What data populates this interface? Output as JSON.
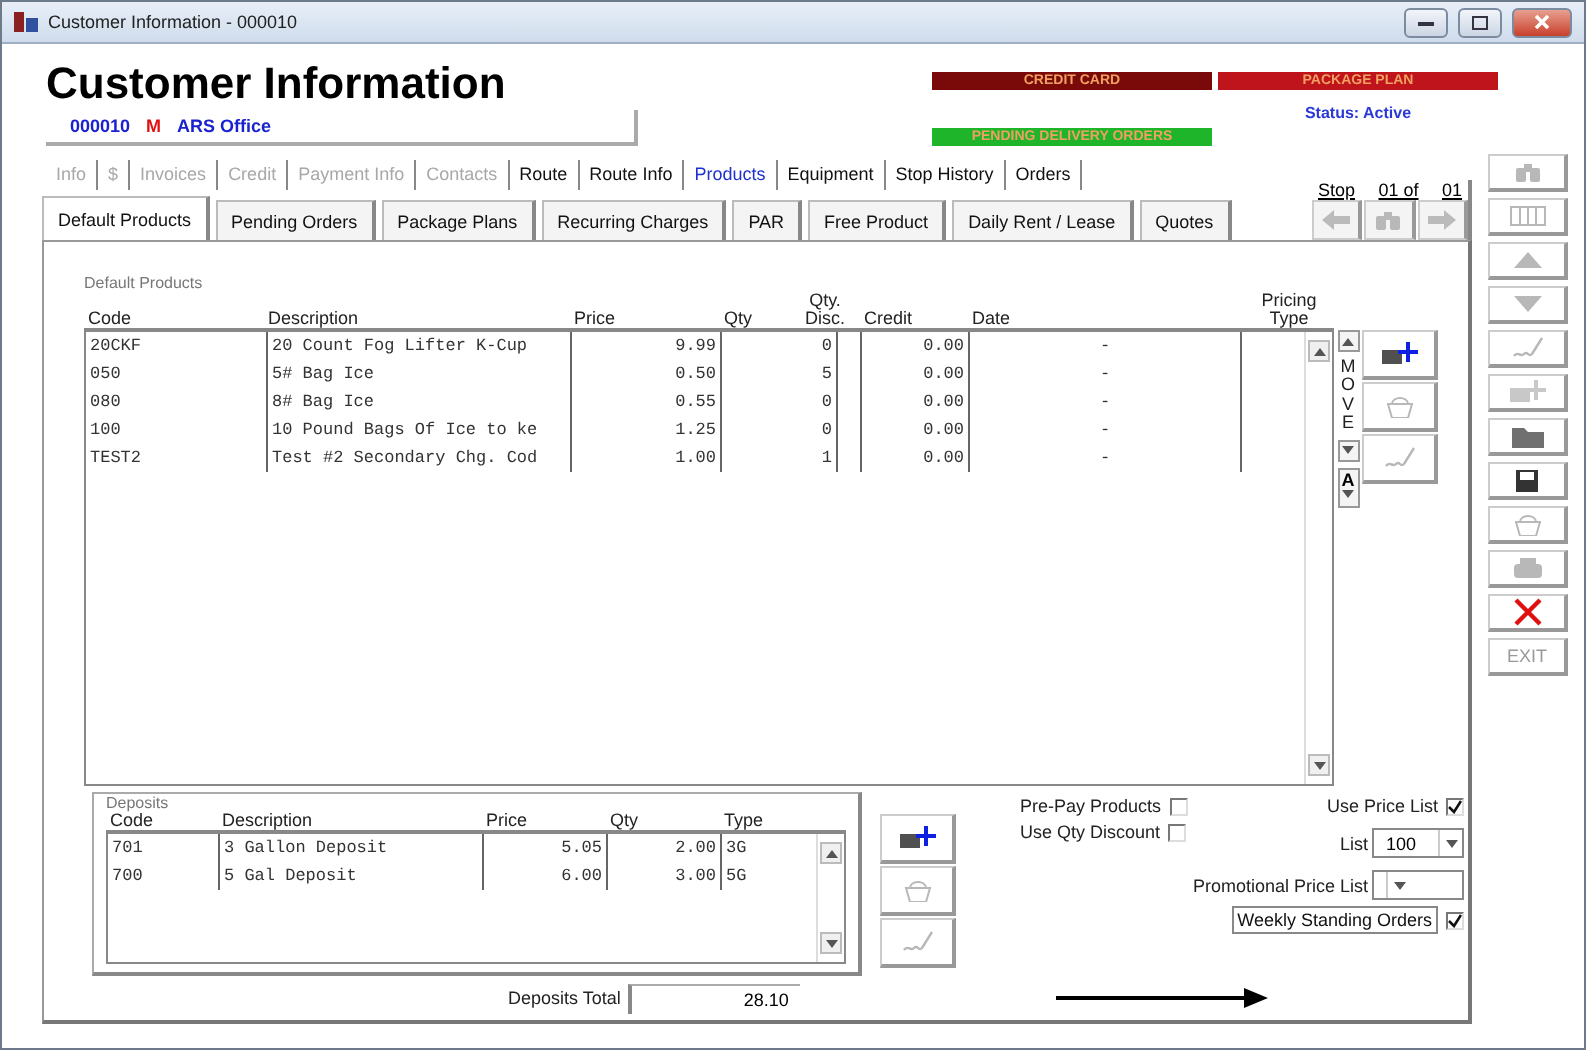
{
  "window": {
    "title": "Customer Information - 000010"
  },
  "heading": "Customer Information",
  "customer": {
    "code": "000010",
    "flag": "M",
    "name": "ARS Office"
  },
  "badges": [
    {
      "label": "CREDIT CARD",
      "color": "#7a0a0a"
    },
    {
      "label": "PACKAGE PLAN",
      "color": "#c0141c"
    },
    {
      "label": "PENDING DELIVERY ORDERS",
      "color": "#1fb52a"
    }
  ],
  "status": "Status: Active",
  "tabs": [
    {
      "label": "Info",
      "selected": false,
      "disabled": true
    },
    {
      "label": "$",
      "selected": false,
      "disabled": true
    },
    {
      "label": "Invoices",
      "selected": false,
      "disabled": true
    },
    {
      "label": "Credit",
      "selected": false,
      "disabled": true
    },
    {
      "label": "Payment Info",
      "selected": false,
      "disabled": true
    },
    {
      "label": "Contacts",
      "selected": false,
      "disabled": true
    },
    {
      "label": "Route",
      "selected": false,
      "disabled": false
    },
    {
      "label": "Route Info",
      "selected": false,
      "disabled": false
    },
    {
      "label": "Products",
      "selected": true,
      "disabled": false
    },
    {
      "label": "Equipment",
      "selected": false,
      "disabled": false
    },
    {
      "label": "Stop History",
      "selected": false,
      "disabled": false
    },
    {
      "label": "Orders",
      "selected": false,
      "disabled": false
    }
  ],
  "subtabs": [
    {
      "label": "Default Products",
      "selected": true
    },
    {
      "label": "Pending Orders",
      "selected": false
    },
    {
      "label": "Package Plans",
      "selected": false
    },
    {
      "label": "Recurring Charges",
      "selected": false
    },
    {
      "label": "PAR",
      "selected": false
    },
    {
      "label": "Free Product",
      "selected": false
    },
    {
      "label": "Daily Rent / Lease",
      "selected": false
    },
    {
      "label": "Quotes",
      "selected": false
    }
  ],
  "stop": {
    "label": "Stop",
    "position": "01 of",
    "total": "01"
  },
  "products": {
    "title": "Default Products",
    "columns": [
      "Code",
      "Description",
      "Price",
      "Qty",
      "Qty. Disc.",
      "Credit",
      "Date",
      "Pricing Type"
    ],
    "rows": [
      {
        "code": "20CKF",
        "description": "20 Count Fog Lifter K-Cup",
        "price": "9.99",
        "disc": "0",
        "credit": "0.00",
        "date": "-"
      },
      {
        "code": "050",
        "description": "5# Bag Ice",
        "price": "0.50",
        "disc": "5",
        "credit": "0.00",
        "date": "-"
      },
      {
        "code": "080",
        "description": "8# Bag Ice",
        "price": "0.55",
        "disc": "0",
        "credit": "0.00",
        "date": "-"
      },
      {
        "code": "100",
        "description": "10 Pound Bags Of Ice to ke",
        "price": "1.25",
        "disc": "0",
        "credit": "0.00",
        "date": "-"
      },
      {
        "code": "TEST2",
        "description": "Test #2 Secondary Chg. Cod",
        "price": "1.00",
        "disc": "1",
        "credit": "0.00",
        "date": "-"
      }
    ]
  },
  "move_label": "MOVE",
  "sort_label": "A",
  "product_actions": [
    {
      "kind": "add",
      "disabled": false
    },
    {
      "kind": "delete",
      "disabled": true
    },
    {
      "kind": "edit",
      "disabled": true
    }
  ],
  "deposits": {
    "title": "Deposits",
    "columns": [
      "Code",
      "Description",
      "Price",
      "Qty",
      "Type"
    ],
    "rows": [
      {
        "code": "701",
        "description": "3 Gallon Deposit",
        "price": "5.05",
        "qty": "2.00",
        "type": "3G"
      },
      {
        "code": "700",
        "description": "5 Gal Deposit",
        "price": "6.00",
        "qty": "3.00",
        "type": "5G"
      }
    ]
  },
  "deposit_actions": [
    {
      "kind": "add",
      "disabled": false
    },
    {
      "kind": "delete",
      "disabled": true
    },
    {
      "kind": "edit",
      "disabled": true
    }
  ],
  "options": {
    "prepay": {
      "label": "Pre-Pay Products",
      "checked": false
    },
    "qty_discount": {
      "label": "Use Qty Discount",
      "checked": false
    },
    "use_price_list": {
      "label": "Use Price List",
      "checked": true
    },
    "list": {
      "label": "List",
      "value": "100"
    },
    "promo": {
      "label": "Promotional Price List"
    },
    "weekly": {
      "label": "Weekly Standing Orders",
      "checked": true
    }
  },
  "deposits_total": {
    "label": "Deposits Total",
    "value": "28.10"
  },
  "toolbar": [
    {
      "kind": "find",
      "disabled": true
    },
    {
      "kind": "grid",
      "disabled": true
    },
    {
      "kind": "up",
      "disabled": true
    },
    {
      "kind": "down",
      "disabled": true
    },
    {
      "kind": "edit",
      "disabled": true
    },
    {
      "kind": "add",
      "disabled": true
    },
    {
      "kind": "folder",
      "disabled": false
    },
    {
      "kind": "save",
      "disabled": false
    },
    {
      "kind": "delete",
      "disabled": true
    },
    {
      "kind": "print",
      "disabled": true
    },
    {
      "kind": "close",
      "disabled": false
    },
    {
      "kind": "exit",
      "label": "EXIT",
      "disabled": true
    }
  ]
}
